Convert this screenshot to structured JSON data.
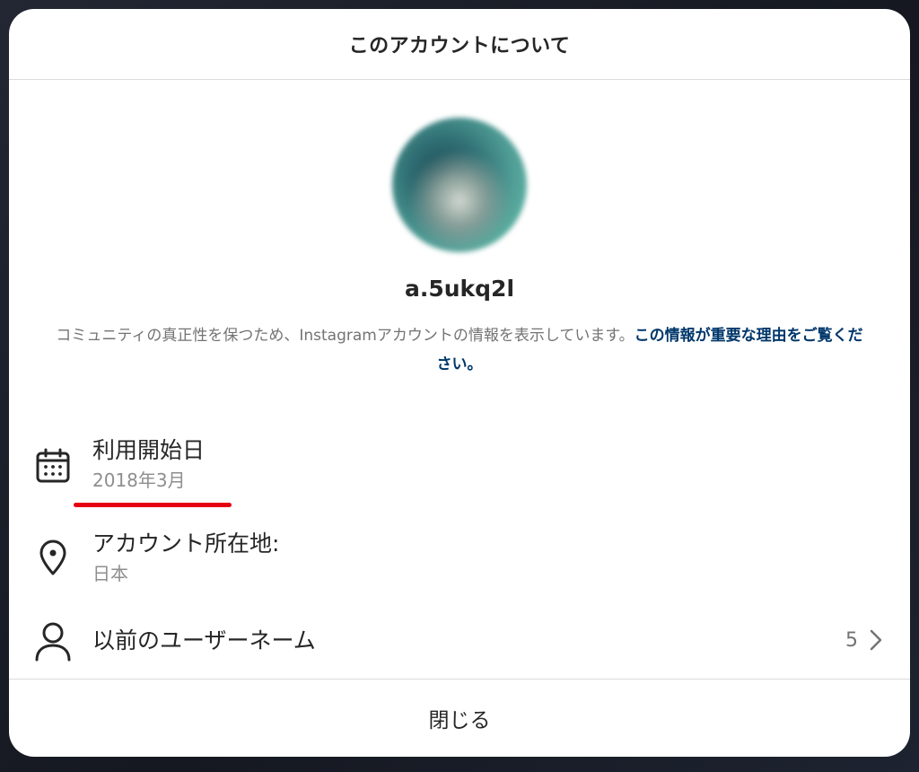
{
  "modal": {
    "title": "このアカウントについて"
  },
  "profile": {
    "username": "a.5ukq2l",
    "description": "コミュニティの真正性を保つため、Instagramアカウントの情報を表示しています。",
    "link_text": "この情報が重要な理由をご覧ください。"
  },
  "rows": {
    "joined": {
      "label": "利用開始日",
      "value": "2018年3月",
      "icon": "calendar-icon"
    },
    "location": {
      "label": "アカウント所在地:",
      "value": "日本",
      "icon": "location-pin-icon"
    },
    "former_usernames": {
      "label": "以前のユーザーネーム",
      "count": "5",
      "icon": "user-icon"
    }
  },
  "footer": {
    "close_label": "閉じる"
  },
  "colors": {
    "link": "#00376b",
    "highlight_underline": "#e60012",
    "secondary_text": "#8e8e8e"
  }
}
